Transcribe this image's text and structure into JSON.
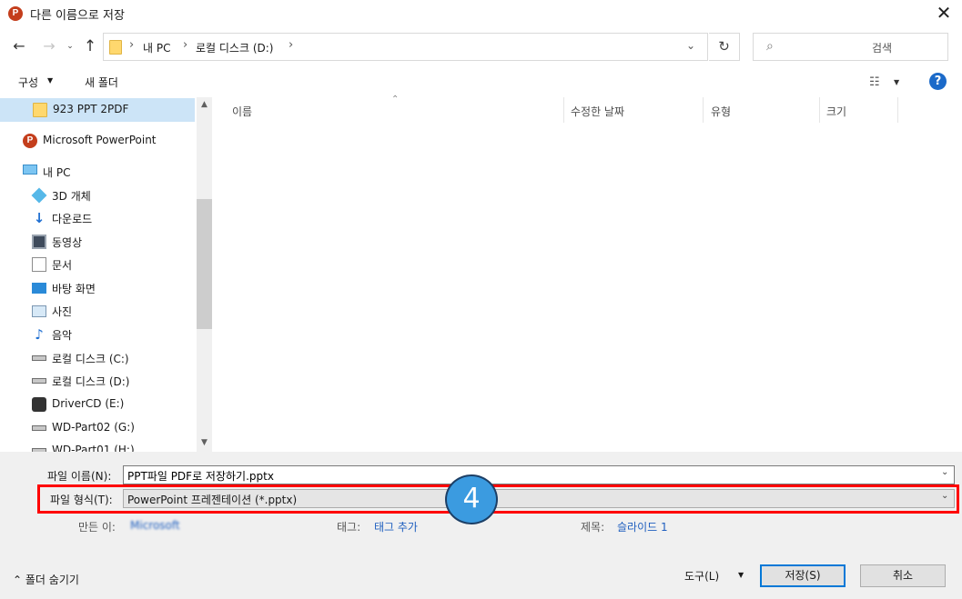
{
  "window": {
    "title": "다른 이름으로 저장",
    "app_icon": "powerpoint-icon",
    "close_glyph": "✕"
  },
  "nav": {
    "back": "←",
    "forward": "→",
    "recent": "⌄",
    "up": "↑",
    "breadcrumb": [
      "내 PC",
      "로컬 디스크 (D:)"
    ],
    "separator": "›",
    "dropdown": "⌄",
    "refresh": "↻",
    "search_placeholder": "검색"
  },
  "toolbar": {
    "organize": "구성",
    "new_folder": "새 폴더",
    "help": "?"
  },
  "sidebar": {
    "items": [
      {
        "label": "923 PPT 2PDF",
        "icon": "folder-icon",
        "selected": true
      },
      {
        "label": "Microsoft PowerPoint",
        "icon": "powerpoint-icon"
      },
      {
        "label": "내 PC",
        "icon": "computer-icon"
      },
      {
        "label": "3D 개체",
        "icon": "3d-objects-icon"
      },
      {
        "label": "다운로드",
        "icon": "download-icon"
      },
      {
        "label": "동영상",
        "icon": "video-icon"
      },
      {
        "label": "문서",
        "icon": "document-icon"
      },
      {
        "label": "바탕 화면",
        "icon": "desktop-icon"
      },
      {
        "label": "사진",
        "icon": "picture-icon"
      },
      {
        "label": "음악",
        "icon": "music-icon"
      },
      {
        "label": "로컬 디스크 (C:)",
        "icon": "drive-icon"
      },
      {
        "label": "로컬 디스크 (D:)",
        "icon": "drive-icon"
      },
      {
        "label": "DriverCD (E:)",
        "icon": "cd-drive-icon"
      },
      {
        "label": "WD-Part02 (G:)",
        "icon": "drive-icon"
      },
      {
        "label": "WD-Part01 (H:)",
        "icon": "drive-icon"
      }
    ]
  },
  "filelist": {
    "columns": [
      "이름",
      "수정한 날짜",
      "유형",
      "크기"
    ]
  },
  "form": {
    "filename_label": "파일 이름(N):",
    "filename_value": "PPT파일 PDF로 저장하기.pptx",
    "filetype_label": "파일 형식(T):",
    "filetype_value": "PowerPoint 프레젠테이션 (*.pptx)",
    "author_label": "만든 이:",
    "author_value": "Microsoft",
    "tags_label": "태그:",
    "tags_value": "태그 추가",
    "title_label": "제목:",
    "title_value": "슬라이드 1",
    "step_number": "4"
  },
  "footer": {
    "hide_folders": "폴더 숨기기",
    "tools": "도구(L)",
    "save": "저장(S)",
    "cancel": "취소"
  },
  "colors": {
    "highlight": "#ff0000",
    "badge": "#3b9be0",
    "selection": "#cce4f7",
    "link": "#1f5fbf"
  }
}
